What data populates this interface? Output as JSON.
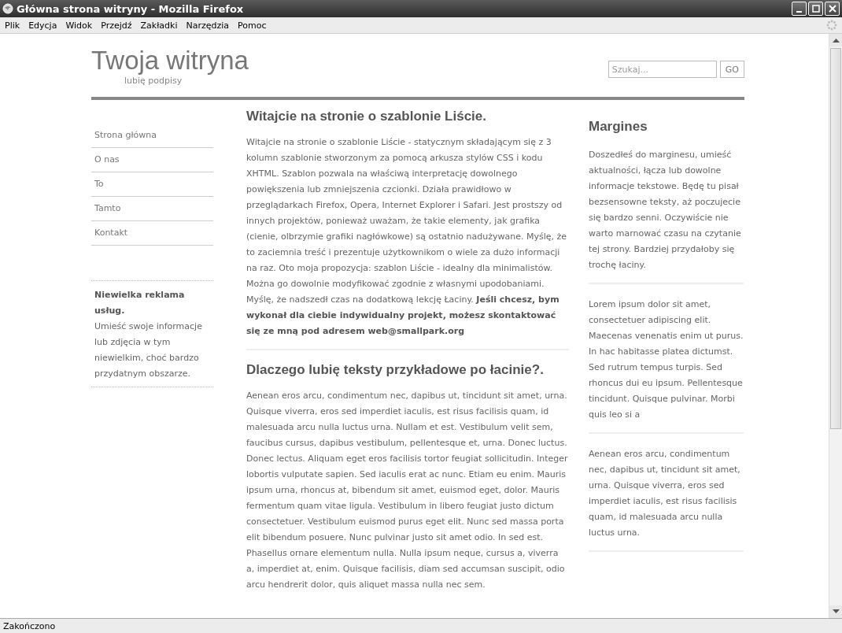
{
  "window": {
    "title": "Główna strona witryny - Mozilla Firefox"
  },
  "menu": [
    "Plik",
    "Edycja",
    "Widok",
    "Przejdź",
    "Zakładki",
    "Narzędzia",
    "Pomoc"
  ],
  "header": {
    "site_title": "Twoja witryna",
    "tagline": "lubię podpisy",
    "search": {
      "placeholder": "Szukaj..."
    },
    "search_button": "GO"
  },
  "nav": [
    {
      "label": "Strona główna"
    },
    {
      "label": "O nas"
    },
    {
      "label": "To"
    },
    {
      "label": "Tamto"
    },
    {
      "label": "Kontakt"
    }
  ],
  "ad": {
    "title": "Niewielka reklama usług.",
    "text": "Umieść swoje informacje lub zdjęcia w tym niewielkim, choć bardzo przydatnym obszarze."
  },
  "main": [
    {
      "heading": "Witajcie na stronie o szablonie Liście.",
      "text": "Witajcie na stronie o szablonie Liście - statycznym składającym się z 3 kolumn szablonie stworzonym za pomocą arkusza stylów CSS i kodu XHTML. Szablon pozwala na właściwą interpretację dowolnego powiększenia lub zmniejszenia czcionki. Działa prawidłowo w przeglądarkach Firefox, Opera, Internet Explorer i Safari. Jest prostszy od innych projektów, ponieważ uważam, że takie elementy, jak grafika (cienie, olbrzymie grafiki nagłówkowe) są ostatnio nadużywane. Myślę, że to zaciemnia treść i prezentuje użytkownikom o wiele za dużo informacji na raz. Oto moja propozycja: szablon Liście - idealny dla minimalistów. Można go dowolnie modyfikować zgodnie z własnymi upodobaniami. Myślę, że nadszedł czas na dodatkową lekcję Łaciny. **Jeśli chcesz, bym wykonał dla ciebie indywidualny projekt, możesz skontaktować się ze mną pod adresem web@smallpark.org**"
    },
    {
      "heading": "Dlaczego lubię teksty przykładowe po łacinie?.",
      "text": "Aenean eros arcu, condimentum nec, dapibus ut, tincidunt sit amet, urna. Quisque viverra, eros sed imperdiet iaculis, est risus facilisis quam, id malesuada arcu nulla luctus urna. Nullam et est. Vestibulum velit sem, faucibus cursus, dapibus vestibulum, pellentesque et, urna. Donec luctus. Donec lectus. Aliquam eget eros facilisis tortor feugiat sollicitudin. Integer lobortis vulputate sapien. Sed iaculis erat ac nunc. Etiam eu enim. Mauris ipsum urna, rhoncus at, bibendum sit amet, euismod eget, dolor. Mauris fermentum quam vitae ligula. Vestibulum in libero feugiat justo dictum consectetuer. Vestibulum euismod purus eget elit. Nunc sed massa porta elit bibendum posuere. Nunc pulvinar justo sit amet odio. In sed est. Phasellus ornare elementum nulla. Nulla ipsum neque, cursus a, viverra a, imperdiet at, enim. Quisque facilisis, diam sed accumsan suscipit, odio arcu hendrerit dolor, quis aliquet massa nulla nec sem."
    }
  ],
  "sidebar": {
    "heading": "Margines",
    "paragraphs": [
      "Doszedłeś do marginesu, umieść aktualności, łącza lub dowolne informacje tekstowe. Będę tu pisał bezsensowne teksty, aż poczujecie się bardzo senni. Oczywiście nie warto marnować czasu na czytanie tej strony. Bardziej przydałoby się trochę łaciny.",
      "Lorem ipsum dolor sit amet, consectetuer adipiscing elit. Maecenas venenatis enim ut purus. In hac habitasse platea dictumst. Sed rutrum tempus turpis. Sed rhoncus dui eu ipsum. Pellentesque tincidunt. Quisque pulvinar. Morbi quis leo si a",
      "Aenean eros arcu, condimentum nec, dapibus ut, tincidunt sit amet, urna. Quisque viverra, eros sed imperdiet iaculis, est risus facilisis quam, id malesuada arcu nulla luctus urna."
    ]
  },
  "status_bar": {
    "text": "Zakończono"
  }
}
